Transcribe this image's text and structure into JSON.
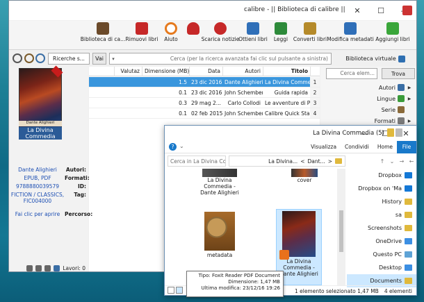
{
  "calibre": {
    "title": "calibre - || Biblioteca di calibre ||",
    "window_controls": {
      "close": "✕",
      "maximize": "☐",
      "minimize": "—"
    },
    "toolbar": [
      {
        "label": "Aggiungi libri",
        "icon": "add-book-icon",
        "color": "#3aa63a"
      },
      {
        "label": "Modifica metadati",
        "icon": "edit-metadata-icon",
        "color": "#2f6fb8"
      },
      {
        "label": "Converti libri",
        "icon": "convert-books-icon",
        "color": "#b58a2a"
      },
      {
        "label": "Leggi",
        "icon": "read-icon",
        "color": "#2d8a3a"
      },
      {
        "label": "Ottieni libri",
        "icon": "get-books-icon",
        "color": "#2f6fb8"
      },
      {
        "label": "Scarica notizie",
        "icon": "news-icon",
        "color": "#c62828"
      },
      {
        "label": "Scarica notizie",
        "icon": "heart-icon",
        "color": "#c62828"
      },
      {
        "label": "Aiuto",
        "icon": "help-icon",
        "color": "#e57a1e"
      },
      {
        "label": "Rimuovi libri",
        "icon": "remove-books-icon",
        "color": "#c62828"
      },
      {
        "label": "Biblioteca di ca...",
        "icon": "library-icon",
        "color": "#6b4a2a"
      }
    ],
    "search": {
      "virtual_library": "Biblioteca virtuale",
      "placeholder": "Cerca (per la ricerca avanzata fai clic sul pulsante a sinistra)",
      "go": "Vai",
      "saved_searches": "Ricerche s..."
    },
    "tag_browser": {
      "find_placeholder": "Cerca elem...",
      "find_button": "Trova",
      "items": [
        {
          "label": "Autori"
        },
        {
          "label": "Lingue"
        },
        {
          "label": "Serie"
        },
        {
          "label": "Formati"
        }
      ]
    },
    "book_list": {
      "headers": [
        "Titolo",
        "Autori",
        "Data",
        "Dimensione (MB)",
        "Valutaz"
      ],
      "rows": [
        {
          "num": "1",
          "title": "La Divina Commedia",
          "author": "Dante Alighieri",
          "date": "23 dic 2016",
          "size": "1.5",
          "rating": ""
        },
        {
          "num": "2",
          "title": "Guida rapida",
          "author": "John Schember",
          "date": "23 dic 2016",
          "size": "0.1",
          "rating": ""
        },
        {
          "num": "3",
          "title": "Le avventure di Pinocc...",
          "author": "Carlo Collodi",
          "date": "29 mag 2...",
          "size": "0.3",
          "rating": ""
        },
        {
          "num": "4",
          "title": "Calibre Quick Start Guide",
          "author": "John Schember",
          "date": "02 feb 2015",
          "size": "0.1",
          "rating": ""
        }
      ]
    },
    "details": {
      "cover_author": "Dante Alighieri",
      "cover_title": "La Divina Commedia",
      "fields": [
        {
          "key": "Autori:",
          "value": "Dante Alighieri"
        },
        {
          "key": "Formati:",
          "value": "EPUB, PDF"
        },
        {
          "key": "ID:",
          "value": "9788880039579"
        },
        {
          "key": "Tag:",
          "value": "FICTION / CLASSICS, FIC004000"
        },
        {
          "key": "Percorso:",
          "value": "Fai clic per aprire"
        }
      ]
    },
    "status": {
      "jobs": "Lavori: 0"
    }
  },
  "explorer": {
    "title": "La Divina Commedia (5)",
    "controls": {
      "close": "✕",
      "maximize": "☐",
      "minimize": "—"
    },
    "ribbon_tabs": [
      "File",
      "Home",
      "Condividi",
      "Visualizza"
    ],
    "breadcrumb": [
      "Dant...",
      "La Divina...",
      ">"
    ],
    "search_placeholder": "Cerca in La Divina Co...",
    "nav_items": [
      {
        "label": "Dropbox",
        "icon": "dropbox-icon",
        "kind": "drop"
      },
      {
        "label": "Dropbox on 'Ma",
        "icon": "dropbox-icon",
        "kind": "drop"
      },
      {
        "label": "History",
        "icon": "folder-icon",
        "kind": "folder"
      },
      {
        "label": "sa",
        "icon": "folder-icon",
        "kind": "folder"
      },
      {
        "label": "Screenshots",
        "icon": "folder-icon",
        "kind": "folder"
      },
      {
        "label": "OneDrive",
        "icon": "onedrive-icon",
        "kind": "blue"
      },
      {
        "label": "Questo PC",
        "icon": "pc-icon",
        "kind": "pc"
      },
      {
        "label": "Desktop",
        "icon": "desktop-icon",
        "kind": "blue"
      },
      {
        "label": "Documents",
        "icon": "documents-icon",
        "kind": "folder"
      }
    ],
    "files": [
      {
        "name": "cover"
      },
      {
        "name": "La Divina Commedia - Dante Alighieri"
      },
      {
        "name": "La Divina Commedia - Dante Alighieri"
      },
      {
        "name": "metadata"
      }
    ],
    "status": {
      "count": "4 elementi",
      "selected": "1 elemento selezionato 1,47 MB"
    },
    "tooltip": {
      "line1": "Tipo: Foxit Reader PDF Document",
      "line2": "Dimensione: 1,47 MB",
      "line3": "Ultima modifica: 23/12/16 19:26"
    }
  }
}
